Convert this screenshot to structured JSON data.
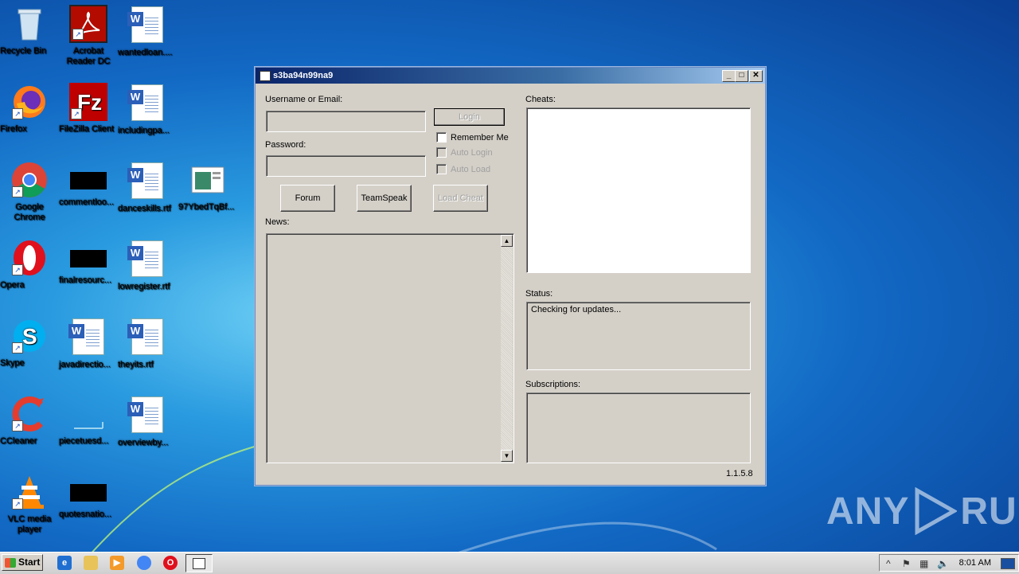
{
  "desktop": {
    "icons": [
      {
        "label": "Recycle Bin"
      },
      {
        "label": "Acrobat Reader DC"
      },
      {
        "label": "wantedloan...."
      },
      {
        "label": "Firefox"
      },
      {
        "label": "FileZilla Client"
      },
      {
        "label": "includingpa..."
      },
      {
        "label": "Google Chrome"
      },
      {
        "label": "commentloo..."
      },
      {
        "label": "danceskills.rtf"
      },
      {
        "label": "97YbedTqBf..."
      },
      {
        "label": "Opera"
      },
      {
        "label": "finalresourc..."
      },
      {
        "label": "lowregister.rtf"
      },
      {
        "label": "Skype"
      },
      {
        "label": "javadirectio..."
      },
      {
        "label": "theyits.rtf"
      },
      {
        "label": "CCleaner"
      },
      {
        "label": "piecetuesd..."
      },
      {
        "label": "overviewby..."
      },
      {
        "label": "VLC media player"
      },
      {
        "label": "quotesnatio..."
      }
    ]
  },
  "window": {
    "title": "s3ba94n99na9",
    "controls": {
      "minimize": "_",
      "maximize": "□",
      "close": "✕"
    },
    "username_label": "Username or Email:",
    "password_label": "Password:",
    "login_button": "Login",
    "remember_me": "Remember Me",
    "auto_login": "Auto Login",
    "auto_load": "Auto Load",
    "forum_button": "Forum",
    "teamspeak_button": "TeamSpeak",
    "load_cheat_button": "Load Cheat",
    "news_label": "News:",
    "cheats_label": "Cheats:",
    "status_label": "Status:",
    "status_text": "Checking for updates...",
    "subscriptions_label": "Subscriptions:",
    "version": "1.1.5.8"
  },
  "taskbar": {
    "start_label": "Start",
    "clock": "8:01 AM"
  },
  "watermark": {
    "left": "ANY",
    "right": "RUN"
  }
}
